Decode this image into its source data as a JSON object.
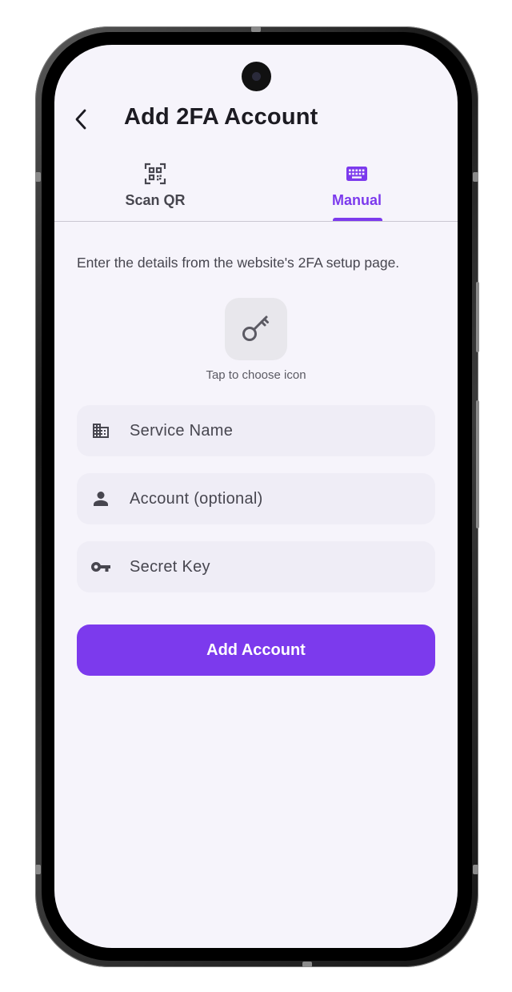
{
  "header": {
    "title": "Add 2FA Account",
    "back_icon": "chevron-left-icon"
  },
  "tabs": [
    {
      "label": "Scan QR",
      "icon": "qr-scanner-icon",
      "selected": false
    },
    {
      "label": "Manual",
      "icon": "keyboard-icon",
      "selected": true
    }
  ],
  "main": {
    "instructions": "Enter the details from the website's 2FA setup page.",
    "icon_picker": {
      "icon": "key-icon",
      "caption": "Tap to choose icon"
    },
    "fields": [
      {
        "placeholder": "Service Name",
        "value": "",
        "icon": "business-icon"
      },
      {
        "placeholder": "Account (optional)",
        "value": "",
        "icon": "person-icon"
      },
      {
        "placeholder": "Secret Key",
        "value": "",
        "icon": "vpn-key-icon"
      }
    ],
    "submit_label": "Add Account"
  },
  "colors": {
    "accent": "#7c3aed",
    "background": "#f6f4fb",
    "field_background": "#efedf6",
    "text_primary": "#1c1b22",
    "text_secondary": "#47464f"
  }
}
